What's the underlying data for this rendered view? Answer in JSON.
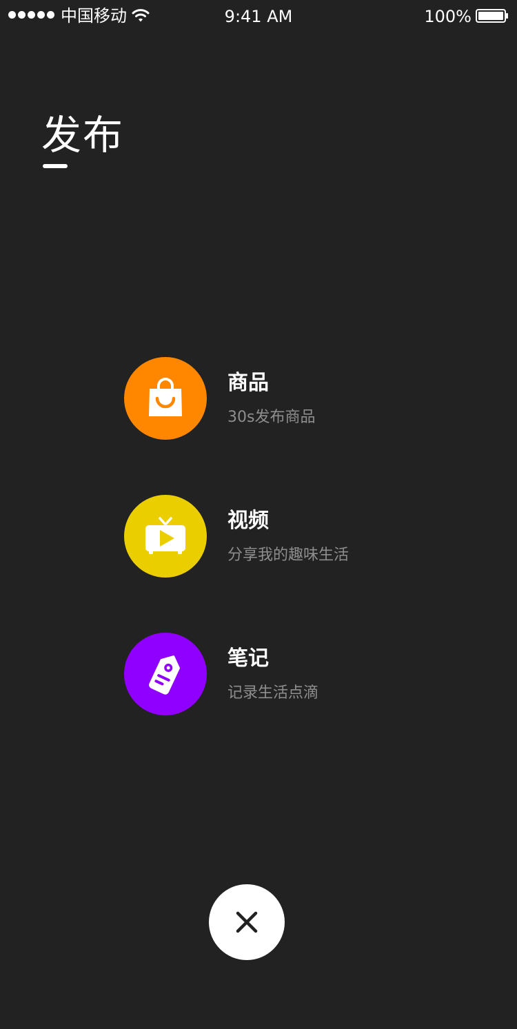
{
  "status_bar": {
    "carrier": "中国移动",
    "time": "9:41 AM",
    "battery": "100%"
  },
  "header": {
    "title": "发布"
  },
  "options": [
    {
      "title": "商品",
      "description": "30s发布商品",
      "icon": "shopping-bag-icon",
      "color": "#FF8700"
    },
    {
      "title": "视频",
      "description": "分享我的趣味生活",
      "icon": "tv-play-icon",
      "color": "#EBCE00"
    },
    {
      "title": "笔记",
      "description": "记录生活点滴",
      "icon": "tag-note-icon",
      "color": "#9000FF"
    }
  ],
  "close": {
    "icon": "close-icon"
  },
  "colors": {
    "background": "#222222",
    "secondary_text": "#8E8E8E"
  }
}
